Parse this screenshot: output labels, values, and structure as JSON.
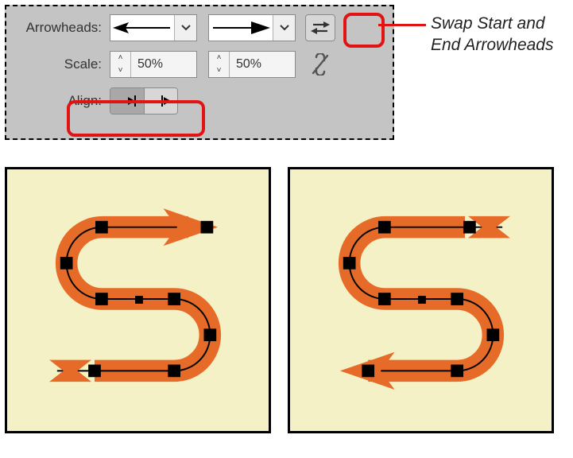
{
  "panel": {
    "arrowheads_label": "Arrowheads:",
    "scale_label": "Scale:",
    "align_label": "Align:",
    "start_scale": "50%",
    "end_scale": "50%"
  },
  "callout": "Swap Start and End Arrowheads",
  "icons": {
    "swap": "swap-arrows-icon",
    "link": "unlink-icon",
    "align_in": "align-inside-icon",
    "align_out": "align-outside-icon",
    "caret": "chevron-down-icon",
    "step_up": "step-up-icon",
    "step_down": "step-down-icon"
  },
  "colors": {
    "highlight": "#e11313",
    "stroke_orange": "#e76b28",
    "artboard_bg": "#f5f1c7"
  }
}
